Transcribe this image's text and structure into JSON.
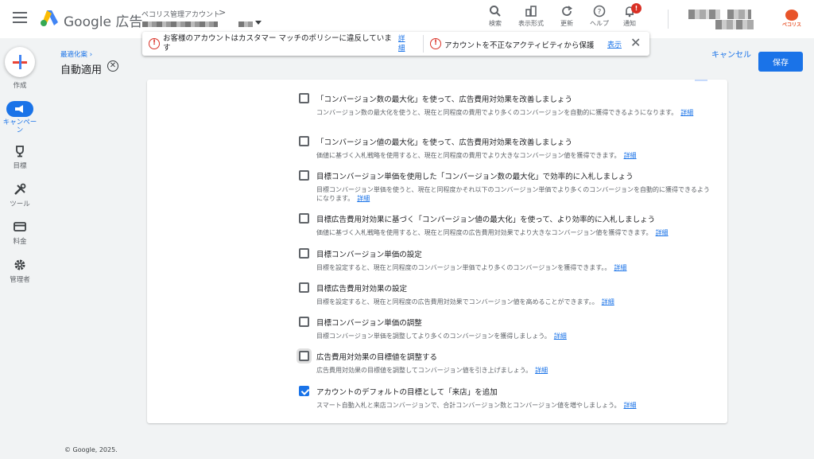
{
  "header": {
    "product": "Google 広告",
    "account_label": "ペコリス管理アカウント",
    "tools": [
      {
        "label": "検索"
      },
      {
        "label": "表示形式"
      },
      {
        "label": "更新"
      },
      {
        "label": "ヘルプ"
      },
      {
        "label": "通知",
        "badge": "!"
      }
    ],
    "brand_text": "ペコリス"
  },
  "banners": {
    "policy_text": "お客様のアカウントはカスタマー マッチのポリシーに違反しています",
    "policy_link": "詳細",
    "activity_text": "アカウントを不正なアクティビティから保護",
    "activity_link": "表示",
    "warn_glyph": "!",
    "close_glyph": "✕"
  },
  "nav": {
    "create": "作成",
    "campaigns": "キャンペーン",
    "goals": "目標",
    "tools": "ツール",
    "billing": "料金",
    "admin": "管理者"
  },
  "subheader": {
    "breadcrumb": "最適化案",
    "breadcrumb_chevron": "›",
    "title": "自動適用",
    "close_glyph": "✕",
    "cancel": "キャンセル",
    "save": "保存"
  },
  "options": [
    {
      "title": "「コンバージョン数の最大化」を使って、広告費用対効果を改善しましょう",
      "desc": "コンバージョン数の最大化を使うと、現在と同程度の費用でより多くのコンバージョンを自動的に獲得できるようになります。",
      "link": "詳細",
      "checked": false
    },
    {
      "title": "「コンバージョン値の最大化」を使って、広告費用対効果を改善しましょう",
      "desc": "価値に基づく入札戦略を使用すると、現在と同程度の費用でより大きなコンバージョン値を獲得できます。",
      "link": "詳細",
      "checked": false
    },
    {
      "title": "目標コンバージョン単価を使用した「コンバージョン数の最大化」で効率的に入札しましょう",
      "desc": "目標コンバージョン単価を使うと、現在と同程度かそれ以下のコンバージョン単価でより多くのコンバージョンを自動的に獲得できるようになります。",
      "link": "詳細",
      "checked": false
    },
    {
      "title": "目標広告費用対効果に基づく「コンバージョン値の最大化」を使って、より効率的に入札しましょう",
      "desc": "価値に基づく入札戦略を使用すると、現在と同程度の広告費用対効果でより大きなコンバージョン値を獲得できます。",
      "link": "詳細",
      "checked": false
    },
    {
      "title": "目標コンバージョン単価の設定",
      "desc": "目標を設定すると、現在と同程度のコンバージョン単価でより多くのコンバージョンを獲得できます。。",
      "link": "詳細",
      "checked": false
    },
    {
      "title": "目標広告費用対効果の設定",
      "desc": "目標を設定すると、現在と同程度の広告費用対効果でコンバージョン値を高めることができます。。",
      "link": "詳細",
      "checked": false
    },
    {
      "title": "目標コンバージョン単価の調整",
      "desc": "目標コンバージョン単価を調整してより多くのコンバージョンを獲得しましょう。",
      "link": "詳細",
      "checked": false
    },
    {
      "title": "広告費用対効果の目標値を調整する",
      "desc": "広告費用対効果の目標値を調整してコンバージョン値を引き上げましょう。",
      "link": "詳細",
      "checked": false,
      "focused": true
    },
    {
      "title": "アカウントのデフォルトの目標として「来店」を追加",
      "desc": "スマート自動入札と来店コンバージョンで、合計コンバージョン数とコンバージョン値を増やしましょう。",
      "link": "詳細",
      "checked": true
    }
  ],
  "footer": "© Google, 2025."
}
